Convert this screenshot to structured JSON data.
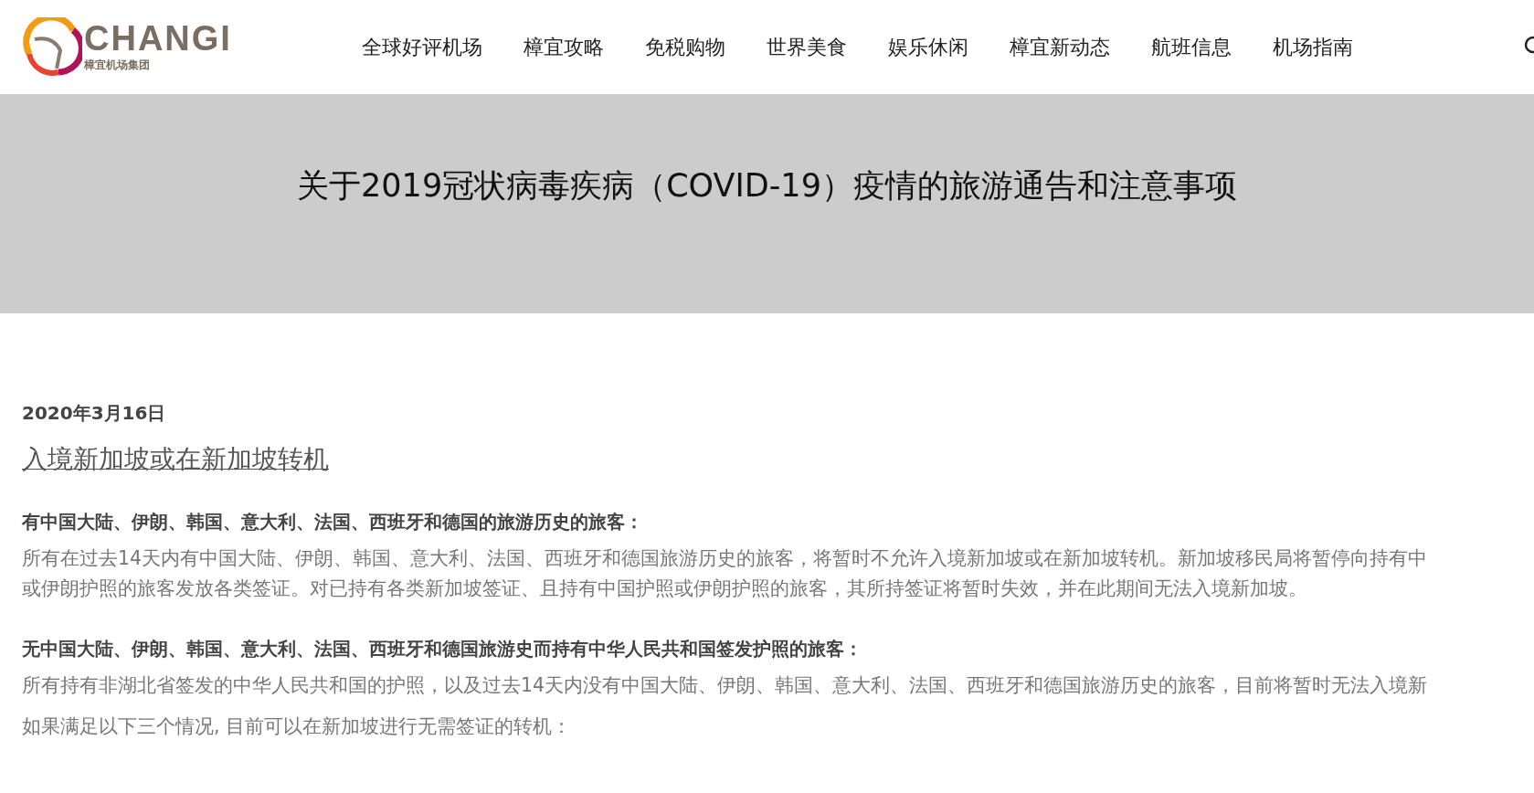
{
  "logo": {
    "name": "CHANGI",
    "subtitle": "樟宜机场集团"
  },
  "nav": [
    "全球好评机场",
    "樟宜攻略",
    "免税购物",
    "世界美食",
    "娱乐休闲",
    "樟宜新动态",
    "航班信息",
    "机场指南"
  ],
  "banner": {
    "title": "关于2019冠状病毒疾病（COVID-19）疫情的旅游通告和注意事项"
  },
  "article": {
    "date": "2020年3月16日",
    "section_link": "入境新加坡或在新加坡转机",
    "blocks": [
      {
        "kind": "heading",
        "text": "有中国大陆、伊朗、韩国、意大利、法国、西班牙和德国的旅游历史的旅客："
      },
      {
        "kind": "paragraph",
        "lines": [
          "所有在过去14天内有中国大陆、伊朗、韩国、意大利、法国、西班牙和德国旅游历史的旅客，将暂时不允许入境新加坡或在新加坡转机。新加坡移民局将暂停向持有中",
          "或伊朗护照的旅客发放各类签证。对已持有各类新加坡签证、且持有中国护照或伊朗护照的旅客，其所持签证将暂时失效，并在此期间无法入境新加坡。"
        ]
      },
      {
        "kind": "heading",
        "text": "无中国大陆、伊朗、韩国、意大利、法国、西班牙和德国旅游史而持有中华人民共和国签发护照的旅客："
      },
      {
        "kind": "paragraph",
        "lines": [
          "所有持有非湖北省签发的中华人民共和国的护照，以及过去14天内没有中国大陆、伊朗、韩国、意大利、法国、西班牙和德国旅游历史的旅客，目前将暂时无法入境新"
        ]
      },
      {
        "kind": "paragraph",
        "lines": [
          "如果满足以下三个情况, 目前可以在新加坡进行无需签证的转机："
        ]
      }
    ]
  }
}
